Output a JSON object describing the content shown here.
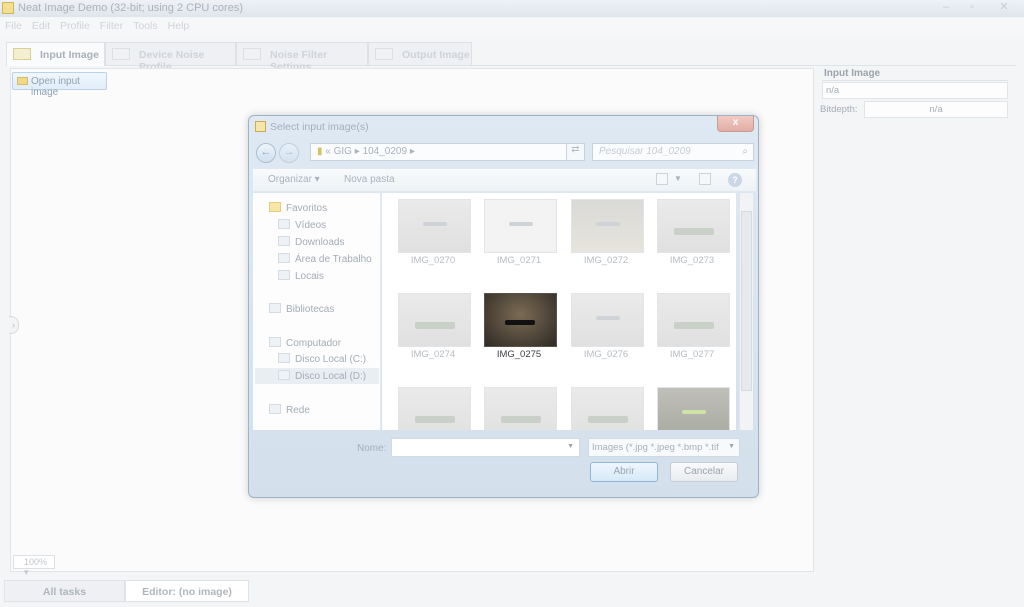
{
  "app": {
    "title": "Neat Image Demo (32-bit; using 2 CPU cores)",
    "menu": [
      "File",
      "Edit",
      "Profile",
      "Filter",
      "Tools",
      "Help"
    ],
    "window_buttons": {
      "minimize": "–",
      "restore": "▫",
      "close": "✕"
    }
  },
  "tabs": [
    {
      "label": "Input Image",
      "active": true
    },
    {
      "label": "Device Noise Profile",
      "active": false
    },
    {
      "label": "Noise Filter Settings",
      "active": false
    },
    {
      "label": "Output Image",
      "active": false
    }
  ],
  "toolbar": {
    "open_label": "Open input image"
  },
  "info": {
    "title": "Input Image",
    "value": "n/a",
    "bitdepth_label": "Bitdepth:",
    "bitdepth_value": "n/a"
  },
  "zoom": "100%",
  "bottom_tabs": [
    "All tasks",
    "Editor: (no image)"
  ],
  "dialog": {
    "title": "Select input image(s)",
    "close": "x",
    "address": {
      "prefix": "«",
      "parts": [
        "GIG",
        "104_0209"
      ],
      "separator": "▸"
    },
    "search_placeholder": "Pesquisar 104_0209",
    "organize": "Organizar",
    "new_folder": "Nova pasta",
    "help": "?",
    "nav": {
      "favorites": "Favoritos",
      "favorites_items": [
        "Vídeos",
        "Downloads",
        "Área de Trabalho",
        "Locais"
      ],
      "libraries": "Bibliotecas",
      "computer": "Computador",
      "computer_items": [
        "Disco Local (C:)",
        "Disco Local (D:)"
      ],
      "network": "Rede"
    },
    "files": [
      {
        "name": "IMG_0270"
      },
      {
        "name": "IMG_0271"
      },
      {
        "name": "IMG_0272"
      },
      {
        "name": "IMG_0273"
      },
      {
        "name": "IMG_0274"
      },
      {
        "name": "IMG_0275"
      },
      {
        "name": "IMG_0276"
      },
      {
        "name": "IMG_0277"
      },
      {
        "name": ""
      },
      {
        "name": ""
      },
      {
        "name": ""
      },
      {
        "name": ""
      }
    ],
    "selected_file": "IMG_0275",
    "name_label": "Nome:",
    "name_value": "",
    "filter": "Images (*.jpg *.jpeg *.bmp *.tif",
    "ok": "Abrir",
    "cancel": "Cancelar"
  }
}
